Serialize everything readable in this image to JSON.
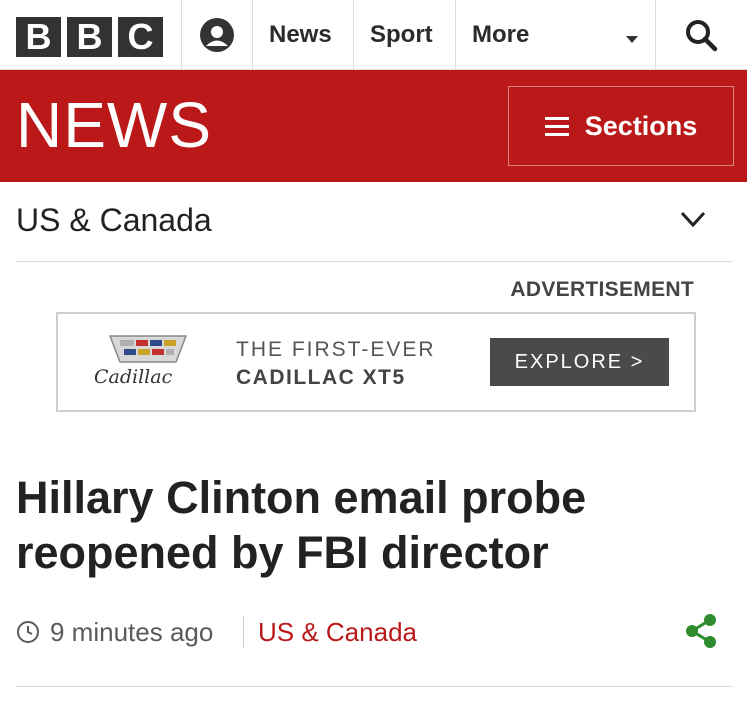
{
  "topbar": {
    "logo_letters": [
      "B",
      "B",
      "C"
    ],
    "nav": {
      "news": "News",
      "sport": "Sport",
      "more": "More"
    },
    "icons": {
      "account": "account-icon",
      "more_caret": "caret-down-icon",
      "search": "search-icon"
    }
  },
  "newsbar": {
    "title": "NEWS",
    "sections_label": "Sections",
    "sections_icon": "hamburger-menu-icon",
    "color": "#bb1919"
  },
  "section": {
    "name": "US & Canada",
    "chevron_icon": "chevron-down-icon"
  },
  "advertisement": {
    "label": "ADVERTISEMENT",
    "brand": "Cadillac",
    "line1": "THE FIRST-EVER",
    "line2": "CADILLAC XT5",
    "cta": "EXPLORE >"
  },
  "article": {
    "headline": "Hillary Clinton email probe reopened by FBI director",
    "timestamp": "9 minutes ago",
    "section_link": "US & Canada",
    "clock_icon": "clock-icon",
    "share_icon": "share-icon",
    "share_color": "#2e8b2e"
  }
}
